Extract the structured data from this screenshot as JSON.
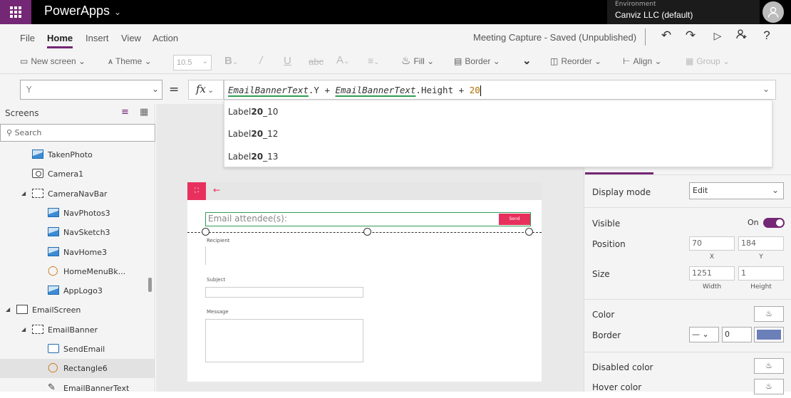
{
  "topbar": {
    "app_name": "PowerApps",
    "env_label": "Environment",
    "env_name": "Canviz LLC (default)"
  },
  "menu": {
    "items": [
      "File",
      "Home",
      "Insert",
      "View",
      "Action"
    ],
    "active": "Home",
    "doc_status": "Meeting Capture - Saved (Unpublished)"
  },
  "ribbon": {
    "new_screen": "New screen",
    "theme": "Theme",
    "font_size": "10.5",
    "fill": "Fill",
    "border": "Border",
    "reorder": "Reorder",
    "align": "Align",
    "group": "Group"
  },
  "formula_bar": {
    "property": "Y",
    "ref1": "EmailBannerText",
    "part1": ".Y + ",
    "ref2": "EmailBannerText",
    "part2": ".Height + ",
    "number": "20"
  },
  "autocomplete": {
    "items": [
      {
        "prefix": "Label",
        "bold": "20",
        "suffix": "_10"
      },
      {
        "prefix": "Label",
        "bold": "20",
        "suffix": "_12"
      },
      {
        "prefix": "Label",
        "bold": "20",
        "suffix": "_13"
      }
    ]
  },
  "left_panel": {
    "title": "Screens",
    "search_placeholder": "Search",
    "tree": [
      {
        "label": "TakenPhoto",
        "icon": "image-icon",
        "indent": 1
      },
      {
        "label": "Camera1",
        "icon": "camera-icon",
        "indent": 1
      },
      {
        "label": "CameraNavBar",
        "icon": "group-icon",
        "indent": 1,
        "expander": true
      },
      {
        "label": "NavPhotos3",
        "icon": "image-icon",
        "indent": 2
      },
      {
        "label": "NavSketch3",
        "icon": "image-icon",
        "indent": 2
      },
      {
        "label": "NavHome3",
        "icon": "image-icon",
        "indent": 2
      },
      {
        "label": "HomeMenuBk...",
        "icon": "shape-icon",
        "indent": 2
      },
      {
        "label": "AppLogo3",
        "icon": "image-icon",
        "indent": 2
      },
      {
        "label": "EmailScreen",
        "icon": "screen-icon",
        "indent": 0,
        "expander": true
      },
      {
        "label": "EmailBanner",
        "icon": "group-icon",
        "indent": 1,
        "expander": true
      },
      {
        "label": "SendEmail",
        "icon": "button-icon",
        "indent": 2
      },
      {
        "label": "Rectangle6",
        "icon": "shape-icon",
        "indent": 2,
        "selected": true
      },
      {
        "label": "EmailBannerText",
        "icon": "text-icon",
        "indent": 2
      }
    ]
  },
  "canvas": {
    "email_placeholder": "Email attendee(s):",
    "send_label": "Send",
    "recipient_label": "Recipient",
    "subject_label": "Subject",
    "message_label": "Message"
  },
  "right_panel": {
    "display_mode_label": "Display mode",
    "display_mode_value": "Edit",
    "visible_label": "Visible",
    "visible_value": "On",
    "position_label": "Position",
    "position_x": "70",
    "position_y": "184",
    "x_label": "X",
    "y_label": "Y",
    "size_label": "Size",
    "width": "1251",
    "height": "1",
    "width_label": "Width",
    "height_label": "Height",
    "color_label": "Color",
    "border_label": "Border",
    "border_width": "0",
    "border_color": "#6b7fb8",
    "disabled_color_label": "Disabled color",
    "hover_color_label": "Hover color"
  },
  "colors": {
    "brand": "#742774",
    "accent": "#e8305d",
    "selection": "#2e9c54"
  }
}
